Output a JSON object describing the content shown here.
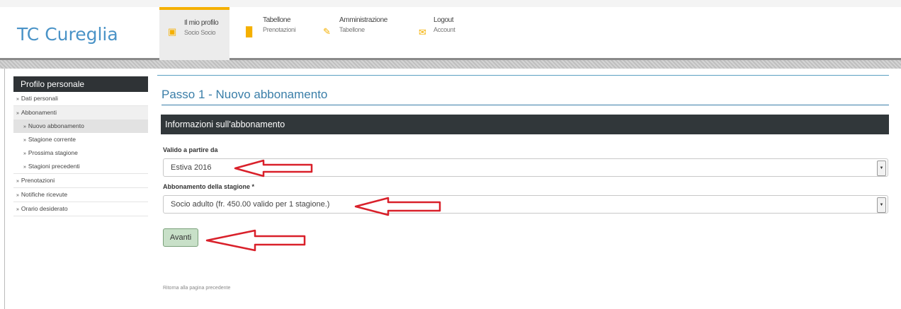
{
  "app": {
    "title": "TC Cureglia"
  },
  "nav": [
    {
      "label": "Il mio profilo",
      "sub": "Socio Socio",
      "icon": "profile-icon",
      "color": "#f5b000"
    },
    {
      "label": "Tabellone",
      "sub": "Prenotazioni",
      "icon": "grid-icon",
      "color": "#f5b000"
    },
    {
      "label": "Amministrazione",
      "sub": "Tabellone",
      "icon": "edit-icon",
      "color": "#f5b000"
    },
    {
      "label": "Logout",
      "sub": "Account",
      "icon": "mail-icon",
      "color": "#f5b000"
    }
  ],
  "sidebar": {
    "title": "Profilo personale",
    "items": [
      {
        "label": "Dati personali"
      },
      {
        "label": "Abbonamenti"
      },
      {
        "label": "Nuovo abbonamento"
      },
      {
        "label": "Stagione corrente"
      },
      {
        "label": "Prossima stagione"
      },
      {
        "label": "Stagioni precedenti"
      },
      {
        "label": "Prenotazioni"
      },
      {
        "label": "Notifiche ricevute"
      },
      {
        "label": "Orario desiderato"
      }
    ]
  },
  "main": {
    "title": "Passo 1 - Nuovo abbonamento",
    "section": "Informazioni sull'abbonamento",
    "valid_from": {
      "label": "Valido a partire da",
      "value": "Estiva 2016"
    },
    "season": {
      "label": "Abbonamento della stagione *",
      "value": "Socio adulto (fr. 450.00 valido per 1 stagione.)"
    },
    "next_button": "Avanti",
    "back_link": "Ritorna alla pagina precedente"
  },
  "colors": {
    "brand": "#4a93c7",
    "accent": "#f5b000",
    "section_bar": "#31373a",
    "annotation_arrow": "#d9202a",
    "button": "#c8e0c8"
  }
}
